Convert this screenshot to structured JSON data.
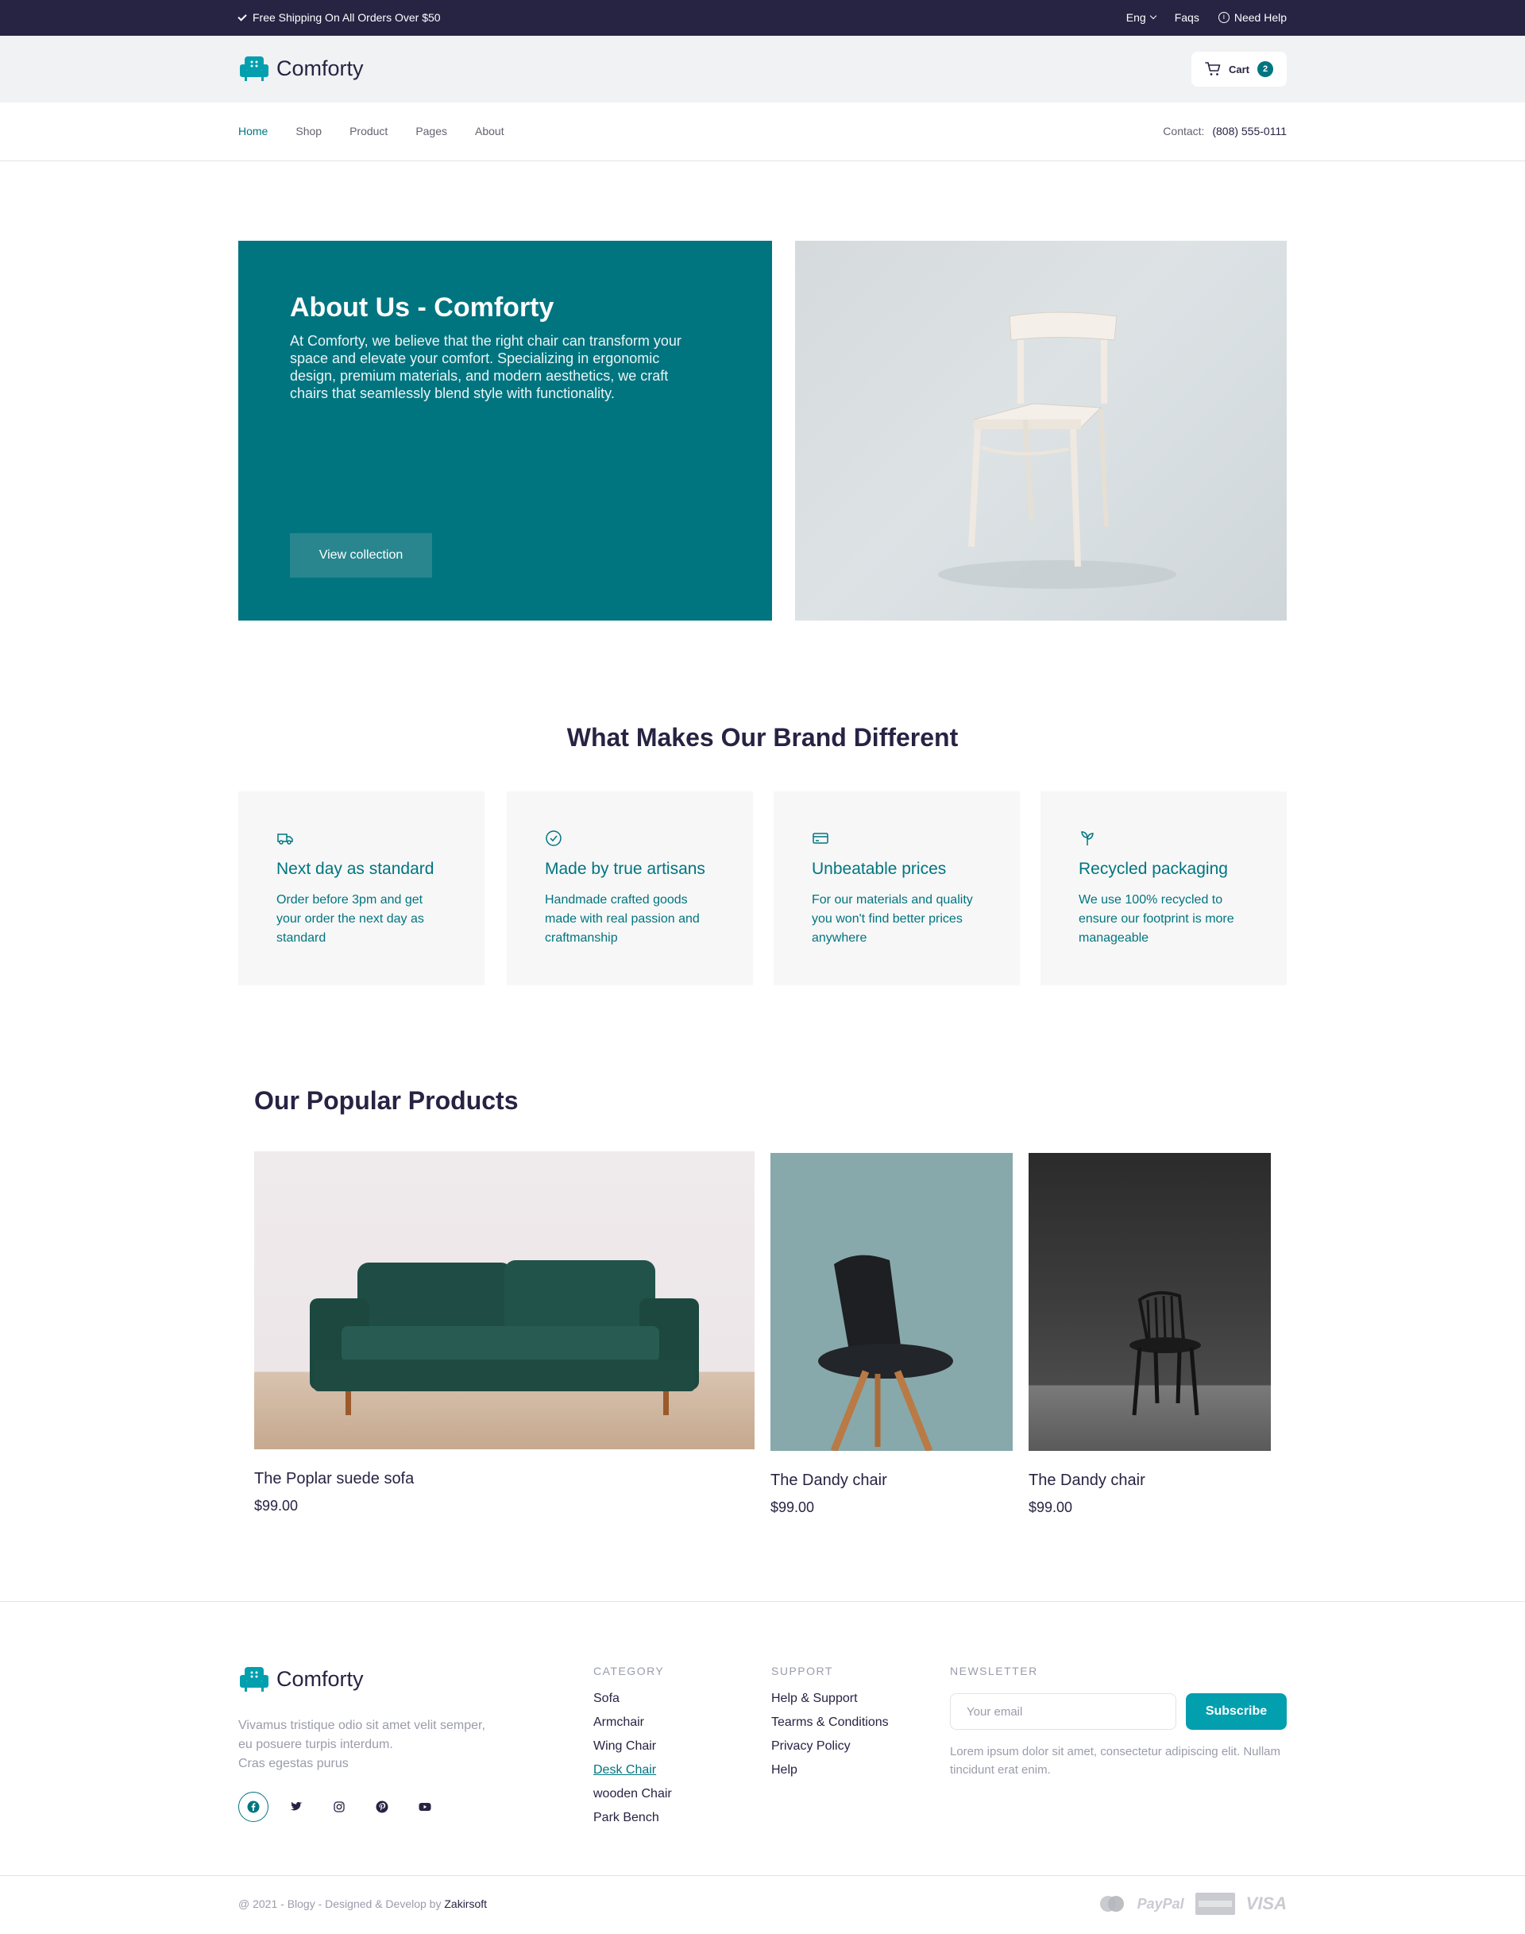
{
  "topbar": {
    "shipping": "Free Shipping On All Orders Over $50",
    "language": "Eng",
    "faqs": "Faqs",
    "help": "Need Help"
  },
  "header": {
    "logo_text": "Comforty",
    "cart_label": "Cart",
    "cart_count": "2"
  },
  "nav": {
    "items": [
      "Home",
      "Shop",
      "Product",
      "Pages",
      "About"
    ],
    "contact_label": "Contact:",
    "contact_phone": "(808) 555-0111"
  },
  "hero": {
    "title": "About Us - Comforty",
    "description": "At Comforty, we believe that the right chair can transform your space and elevate your comfort. Specializing in ergonomic design, premium materials, and modern aesthetics, we craft chairs that seamlessly blend style with functionality.",
    "button": "View collection"
  },
  "features": {
    "title": "What Makes Our Brand Different",
    "items": [
      {
        "icon": "delivery-truck-icon",
        "title": "Next day as standard",
        "text": "Order before 3pm and get your order the next day as standard"
      },
      {
        "icon": "check-circle-icon",
        "title": "Made by true artisans",
        "text": "Handmade crafted goods made with real passion and craftmanship"
      },
      {
        "icon": "credit-card-icon",
        "title": "Unbeatable prices",
        "text": "For our materials and quality you won't find better prices anywhere"
      },
      {
        "icon": "sprout-icon",
        "title": "Recycled packaging",
        "text": "We use 100% recycled to ensure our footprint is more manageable"
      }
    ]
  },
  "products": {
    "title": "Our Popular Products",
    "items": [
      {
        "name": "The Poplar suede sofa",
        "price": "$99.00"
      },
      {
        "name": "The Dandy chair",
        "price": "$99.00"
      },
      {
        "name": "The Dandy chair",
        "price": "$99.00"
      }
    ]
  },
  "footer": {
    "logo_text": "Comforty",
    "description_lines": [
      "Vivamus tristique odio sit amet velit semper,",
      "eu posuere turpis interdum.",
      "Cras egestas purus"
    ],
    "socials": [
      "facebook-icon",
      "twitter-icon",
      "instagram-icon",
      "pinterest-icon",
      "youtube-icon"
    ],
    "category_title": "CATEGORY",
    "categories": [
      "Sofa",
      "Armchair",
      "Wing Chair",
      "Desk Chair",
      "wooden Chair",
      "Park Bench"
    ],
    "support_title": "SUPPORT",
    "support": [
      "Help & Support",
      "Tearms & Conditions",
      "Privacy Policy",
      "Help"
    ],
    "newsletter_title": "NEWSLETTER",
    "email_placeholder": "Your email",
    "subscribe": "Subscribe",
    "newsletter_text": "Lorem ipsum dolor sit amet, consectetur adipiscing elit. Nullam tincidunt erat enim.",
    "copyright_prefix": "@ 2021 - Blogy - Designed & Develop by ",
    "copyright_brand": "Zakirsoft",
    "payments": [
      "PayPal",
      "VISA"
    ]
  },
  "colors": {
    "primary": "#007580",
    "dark": "#272343",
    "accent": "#029fae",
    "muted": "#9a9caa"
  }
}
